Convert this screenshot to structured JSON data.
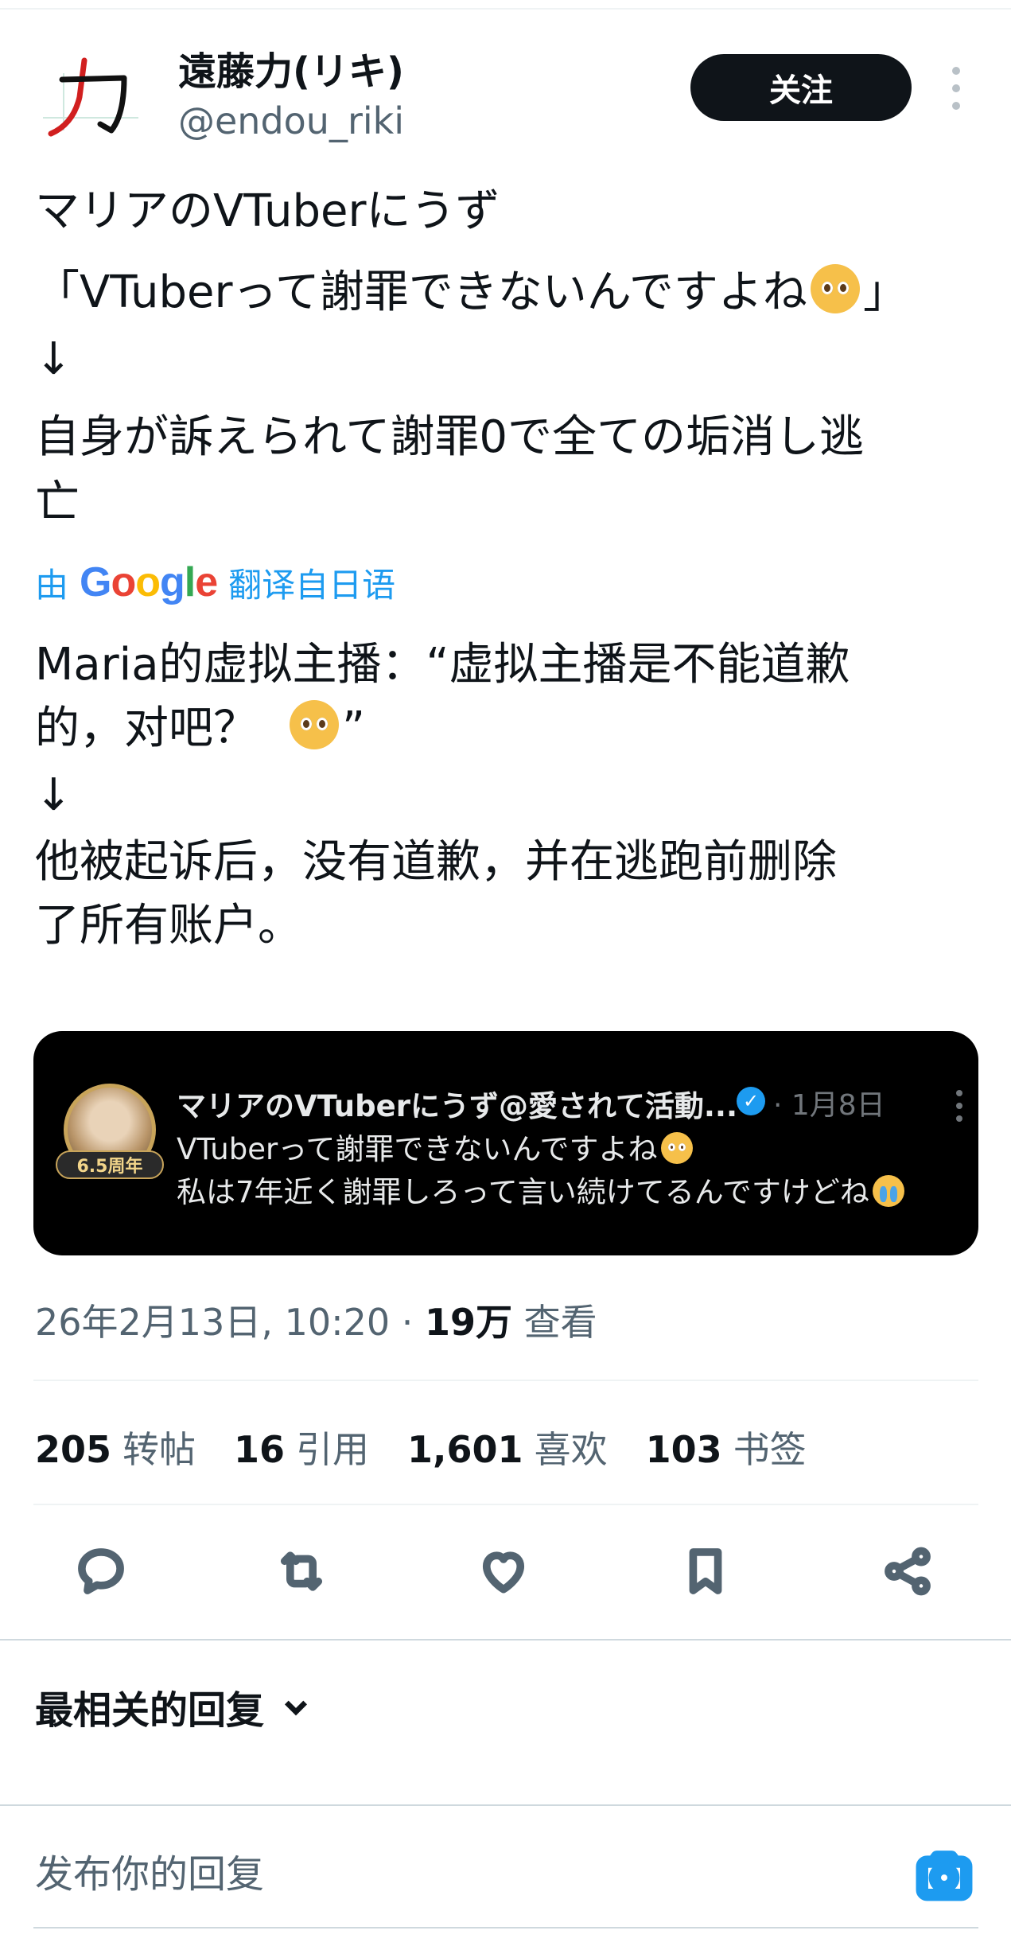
{
  "author": {
    "display_name": "遠藤力(リキ)",
    "handle": "@endou_riki",
    "avatar_glyph": "力",
    "follow_label": "关注"
  },
  "tweet": {
    "original_lines": [
      "マリアのVTuberにうず",
      "「VTuberって謝罪できないんですよね",
      "」",
      "↓",
      "自身が訴えられて謝罪0で全ての垢消し逃",
      "亡"
    ],
    "translate_prefix": "由",
    "translate_brand": "Google",
    "translate_suffix": "翻译自日语",
    "translated_lines": [
      "Maria的虚拟主播：“虚拟主播是不能道歉",
      "的，对吧？",
      "”",
      "↓",
      "他被起诉后，没有道歉，并在逃跑前删除",
      "了所有账户。"
    ]
  },
  "quoted_image": {
    "badge": "6.5周年",
    "name": "マリアのVTuberにうず@愛されて活動...",
    "date": "· 1月8日",
    "line1": "VTuberって謝罪できないんですよね",
    "line2": "私は7年近く謝罪しろって言い続けてるんですけどね"
  },
  "meta": {
    "timestamp": "26年2月13日, 10:20 · ",
    "views_count": "19万",
    "views_label": " 查看"
  },
  "stats": [
    {
      "num": "205",
      "label": "转帖"
    },
    {
      "num": "16",
      "label": "引用"
    },
    {
      "num": "1,601",
      "label": "喜欢"
    },
    {
      "num": "103",
      "label": "书签"
    }
  ],
  "replies": {
    "sort_label": "最相关的回复",
    "input_placeholder": "发布你的回复"
  },
  "icons": [
    "reply-icon",
    "retweet-icon",
    "like-icon",
    "bookmark-icon",
    "share-icon",
    "camera-icon",
    "verified-icon",
    "chevron-down-icon",
    "more-icon"
  ],
  "colors": {
    "accent": "#1d9bf0",
    "text": "#0f1419",
    "secondary": "#536471",
    "follow_bg": "#0f1419"
  }
}
